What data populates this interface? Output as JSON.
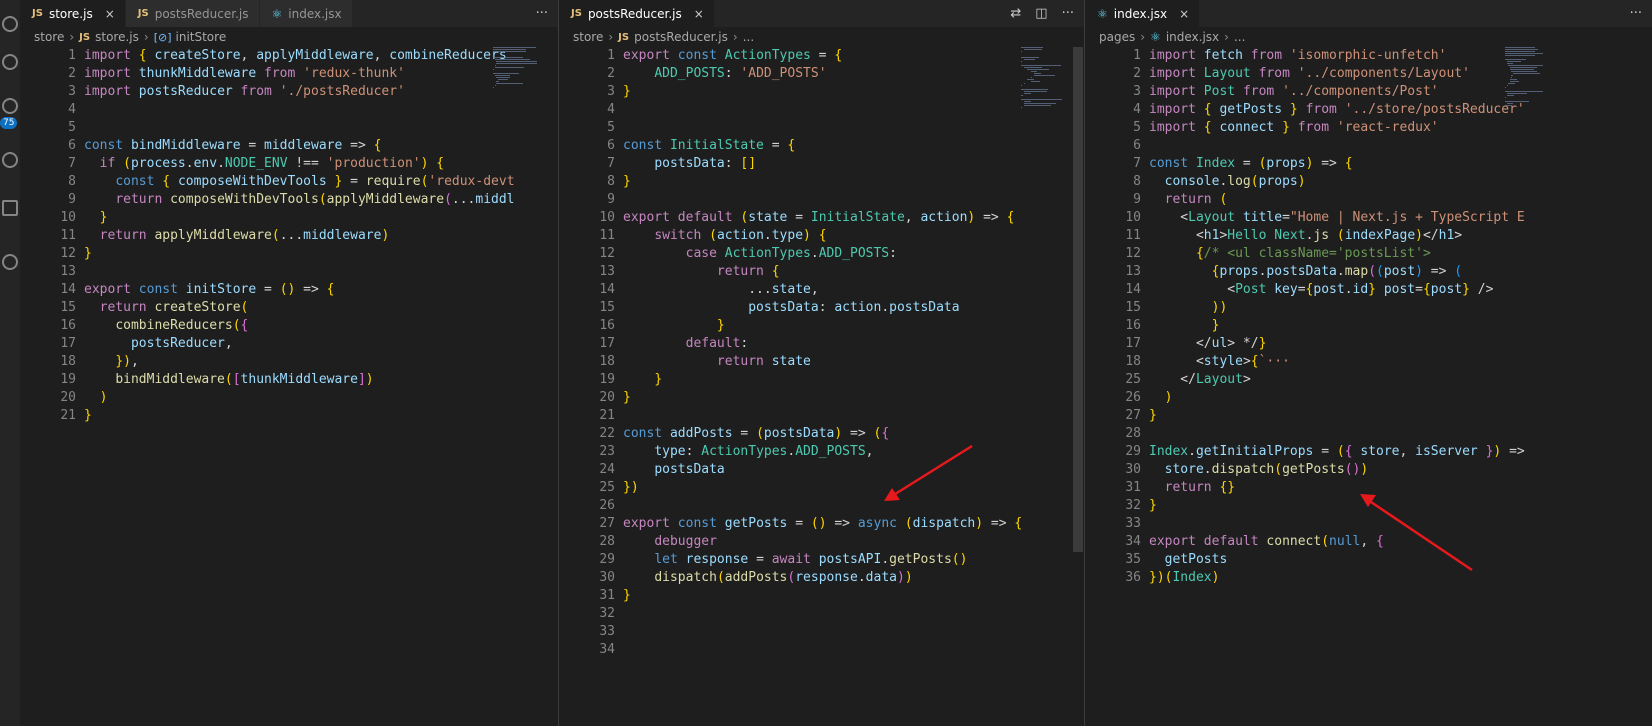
{
  "activity_bar": {
    "badge": "75"
  },
  "panes": [
    {
      "tabs": [
        {
          "label": "store.js",
          "icon": "js-icon",
          "active": true
        },
        {
          "label": "postsReducer.js",
          "icon": "js-icon",
          "active": false
        },
        {
          "label": "index.jsx",
          "icon": "react-icon",
          "active": false
        }
      ],
      "breadcrumb": {
        "folder": "store",
        "file": "store.js",
        "symbol": "initStore"
      },
      "lines": [
        "import { createStore, applyMiddleware, combineReducers",
        "import thunkMiddleware from 'redux-thunk'",
        "import postsReducer from './postsReducer'",
        "",
        "",
        "const bindMiddleware = middleware => {",
        "  if (process.env.NODE_ENV !== 'production') {",
        "    const { composeWithDevTools } = require('redux-devt",
        "    return composeWithDevTools(applyMiddleware(...middl",
        "  }",
        "  return applyMiddleware(...middleware)",
        "}",
        "",
        "export const initStore = () => {",
        "  return createStore(",
        "    combineReducers({",
        "      postsReducer,",
        "    }),",
        "    bindMiddleware([thunkMiddleware])",
        "  )",
        "}"
      ],
      "line_numbers": [
        1,
        2,
        3,
        4,
        5,
        6,
        7,
        8,
        9,
        10,
        11,
        12,
        13,
        14,
        15,
        16,
        17,
        18,
        19,
        20,
        21
      ]
    },
    {
      "tabs": [
        {
          "label": "postsReducer.js",
          "icon": "js-icon",
          "active": true
        }
      ],
      "breadcrumb": {
        "folder": "store",
        "file": "postsReducer.js",
        "symbol": "..."
      },
      "lines": [
        "export const ActionTypes = {",
        "    ADD_POSTS: 'ADD_POSTS'",
        "}",
        "",
        "",
        "const InitialState = {",
        "    postsData: []",
        "}",
        "",
        "export default (state = InitialState, action) => {",
        "    switch (action.type) {",
        "        case ActionTypes.ADD_POSTS:",
        "            return {",
        "                ...state,",
        "                postsData: action.postsData",
        "            }",
        "        default:",
        "            return state",
        "    }",
        "}",
        "",
        "const addPosts = (postsData) => ({",
        "    type: ActionTypes.ADD_POSTS,",
        "    postsData",
        "})",
        "",
        "export const getPosts = () => async (dispatch) => {",
        "    debugger",
        "    let response = await postsAPI.getPosts()",
        "    dispatch(addPosts(response.data))",
        "}",
        "",
        "",
        ""
      ],
      "line_numbers": [
        1,
        2,
        3,
        4,
        5,
        6,
        7,
        8,
        9,
        10,
        11,
        12,
        13,
        14,
        15,
        16,
        17,
        18,
        19,
        20,
        21,
        22,
        23,
        24,
        25,
        26,
        27,
        28,
        29,
        30,
        31,
        32,
        33,
        34
      ]
    },
    {
      "tabs": [
        {
          "label": "index.jsx",
          "icon": "react-icon",
          "active": true
        }
      ],
      "breadcrumb": {
        "folder": "pages",
        "file": "index.jsx",
        "symbol": "..."
      },
      "lines": [
        "import fetch from 'isomorphic-unfetch'",
        "import Layout from '../components/Layout'",
        "import Post from '../components/Post'",
        "import { getPosts } from '../store/postsReducer'",
        "import { connect } from 'react-redux'",
        "",
        "const Index = (props) => {",
        "  console.log(props)",
        "  return (",
        "    <Layout title=\"Home | Next.js + TypeScript E",
        "      <h1>Hello Next.js (indexPage)</h1>",
        "      {/* <ul className='postsList'>",
        "        {props.postsData.map((post) => (",
        "          <Post key={post.id} post={post} />",
        "        ))",
        "        }",
        "      </ul> */}",
        "      <style>{`···",
        "    </Layout>",
        "  )",
        "}",
        "",
        "Index.getInitialProps = ({ store, isServer }) =>",
        "  store.dispatch(getPosts())",
        "  return {}",
        "}",
        "",
        "export default connect(null, {",
        "  getPosts",
        "})(Index)",
        ""
      ],
      "line_numbers": [
        1,
        2,
        3,
        4,
        5,
        6,
        7,
        8,
        9,
        10,
        11,
        12,
        13,
        14,
        15,
        16,
        17,
        18,
        25,
        26,
        27,
        28,
        29,
        30,
        31,
        32,
        33,
        34,
        35,
        36
      ]
    }
  ],
  "colors": {
    "editor_bg": "#1e1e1e",
    "tab_bg": "#252526",
    "annotation_arrow": "#e8191c"
  }
}
